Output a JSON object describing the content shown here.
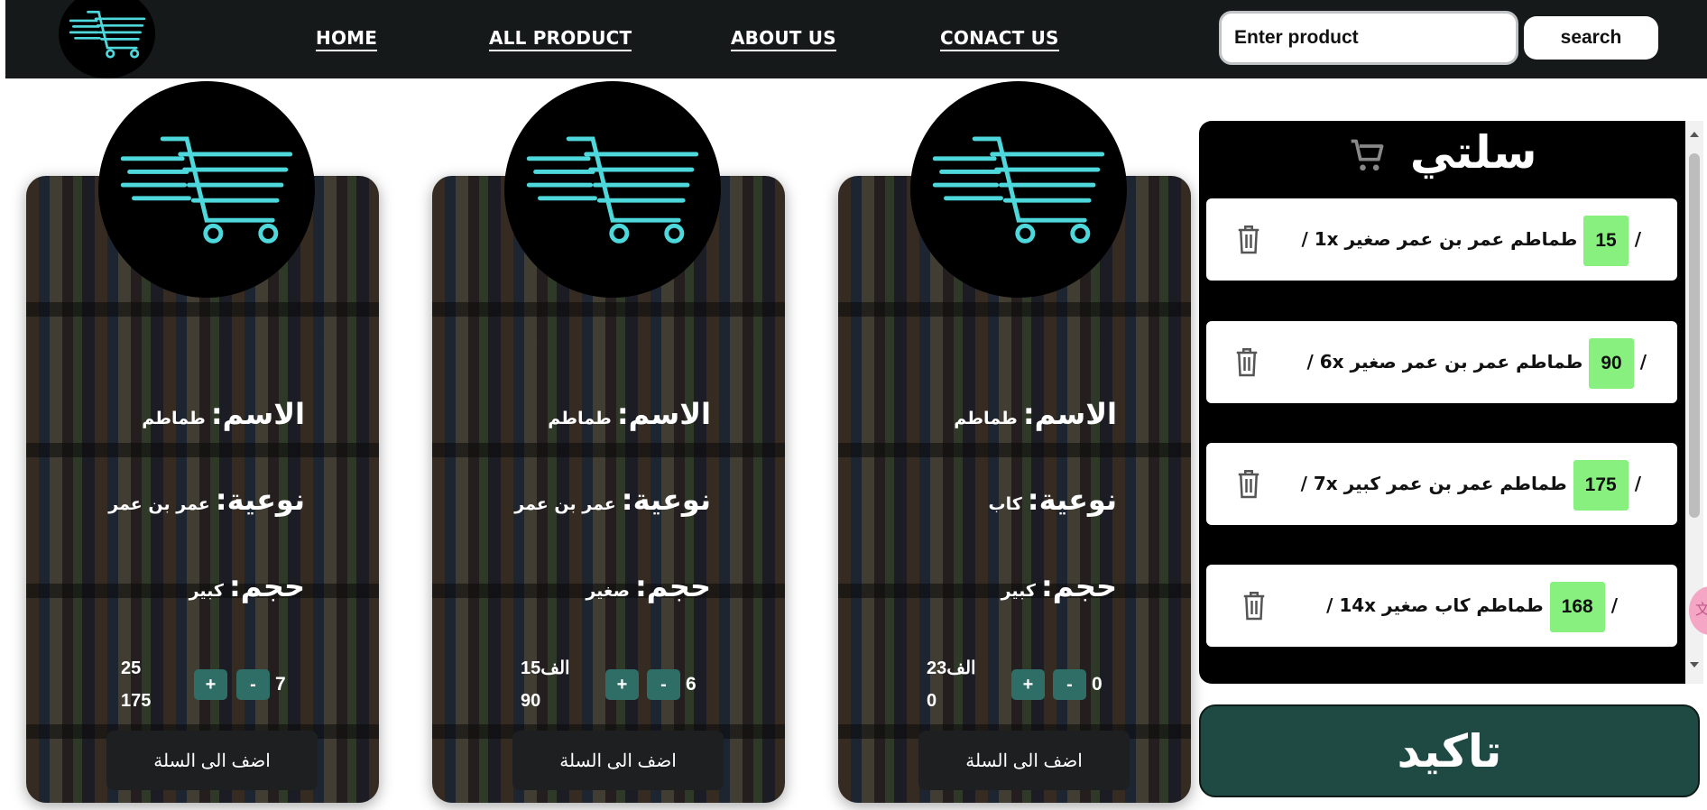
{
  "nav": {
    "links": [
      "HOME",
      "ALL PRODUCT",
      "ABOUT US",
      "CONACT US"
    ],
    "search_placeholder": "Enter product",
    "search_button": "search"
  },
  "products": [
    {
      "name_label": "الاسم:",
      "name": "طماطم",
      "type_label": "نوعية:",
      "type": "عمر بن عمر",
      "size_label": "حجم:",
      "size": "كبير",
      "price_top": "25",
      "price_bottom": "175",
      "plus": "+",
      "minus": "-",
      "qty": "7",
      "add_label": "اضف الى السلة"
    },
    {
      "name_label": "الاسم:",
      "name": "طماطم",
      "type_label": "نوعية:",
      "type": "عمر بن عمر",
      "size_label": "حجم:",
      "size": "صغير",
      "price_top": "الف15",
      "price_bottom": "90",
      "plus": "+",
      "minus": "-",
      "qty": "6",
      "add_label": "اضف الى السلة"
    },
    {
      "name_label": "الاسم:",
      "name": "طماطم",
      "type_label": "نوعية:",
      "type": "كاب",
      "size_label": "حجم:",
      "size": "كبير",
      "price_top": "الف23",
      "price_bottom": "0",
      "plus": "+",
      "minus": "-",
      "qty": "0",
      "add_label": "اضف الى السلة"
    }
  ],
  "cart": {
    "title": "سلتي",
    "items": [
      {
        "price": "15",
        "text": "طماطم عمر بن عمر صغير 1x"
      },
      {
        "price": "90",
        "text": "طماطم عمر بن عمر صغير 6x"
      },
      {
        "price": "175",
        "text": "طماطم عمر بن عمر كبير 7x"
      },
      {
        "price": "168",
        "text": "طماطم كاب صغير 14x"
      }
    ],
    "separator": "/",
    "confirm_label": "تاكيد"
  },
  "colors": {
    "navbar": "#15191a",
    "accent_cyan": "#4fd8dc",
    "qty_button": "#2e6e67",
    "price_badge": "#88f07f",
    "confirm_button": "#1f4a44"
  },
  "icons": [
    "cart-logo-icon",
    "cart-icon",
    "trash-icon",
    "translate-icon"
  ]
}
